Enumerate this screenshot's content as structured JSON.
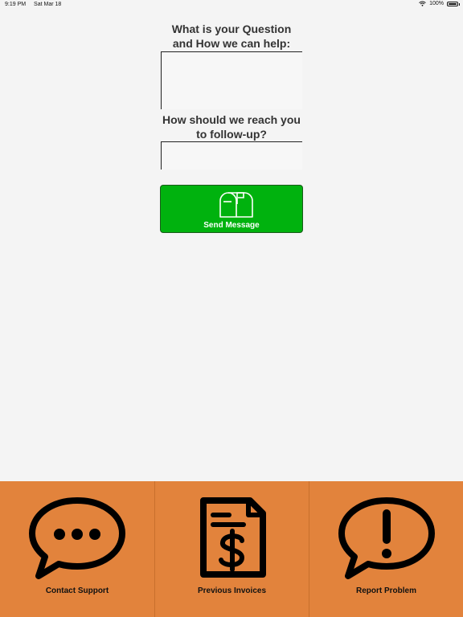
{
  "status_bar": {
    "time": "9:19 PM",
    "date": "Sat Mar 18",
    "battery": "100%",
    "wifi_icon": "wifi-icon",
    "battery_icon": "battery-icon"
  },
  "form": {
    "question_label": "What is your Question and How we can help:",
    "question_value": "",
    "contact_label": "How should we reach you to follow-up?",
    "contact_value": ""
  },
  "send_button": {
    "label": "Send Message",
    "icon": "mailbox-icon",
    "color": "#00b20e"
  },
  "tab_bar": {
    "color": "#e2833c",
    "tabs": [
      {
        "label": "Contact Support",
        "icon": "chat-bubble-icon"
      },
      {
        "label": "Previous Invoices",
        "icon": "invoice-icon"
      },
      {
        "label": "Report Problem",
        "icon": "alert-bubble-icon"
      }
    ]
  }
}
